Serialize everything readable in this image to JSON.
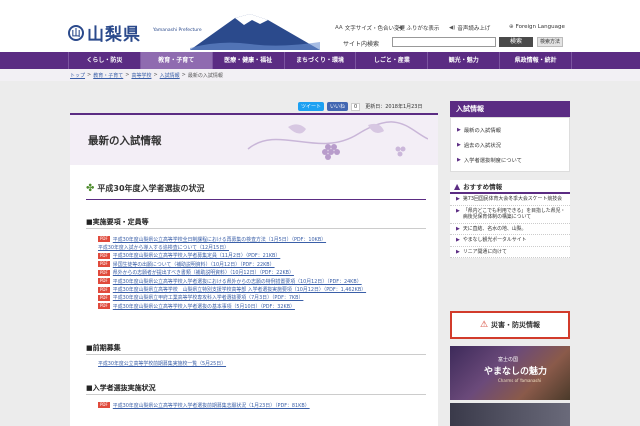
{
  "header": {
    "logo_mark": "山",
    "logo_text": "山梨県",
    "logo_sub": "Yamanashi Prefecture",
    "util_links": [
      {
        "icon": "text-size-icon",
        "glyph": "AA",
        "label": "文字サイズ・色合い変更"
      },
      {
        "icon": "speaker-icon",
        "glyph": "◀)",
        "label": "ふりがな表示"
      },
      {
        "icon": "speaker-icon",
        "glyph": "◀)",
        "label": "音声読み上げ"
      },
      {
        "icon": "globe-icon",
        "glyph": "⊕",
        "label": "Foreign Language"
      }
    ],
    "search_label": "サイト内検索",
    "search_placeholder": "",
    "search_button": "検索",
    "search_method": "検索方法"
  },
  "nav": {
    "items": [
      {
        "label": "くらし・防災"
      },
      {
        "label": "教育・子育て"
      },
      {
        "label": "医療・健康・福祉"
      },
      {
        "label": "まちづくり・環境"
      },
      {
        "label": "しごと・産業"
      },
      {
        "label": "観光・魅力"
      },
      {
        "label": "県政情報・統計"
      }
    ]
  },
  "breadcrumb": {
    "items": [
      "トップ",
      "教育・子育て",
      "高等学校",
      "入試情報",
      "最新の入試情報"
    ]
  },
  "share": {
    "tweet": "ツイート",
    "like": "いいね",
    "like_count": "0",
    "updated": "更新日：2018年1月23日"
  },
  "main": {
    "page_title": "最新の入試情報",
    "section_title": "平成30年度入学者選抜の状況",
    "sections": [
      {
        "heading": "■実施要項・定員等",
        "docs": [
          "平成30年度山梨県公立高等学校全日制課程における再募集の検査方法（1月5日）（PDF：10KB）",
          "平成30年度入試から導入する追検査について（12月15日）",
          "平成30年度山梨県公立高等学校入学者募集定員（11月2日）（PDF：21KB）",
          "帰国生徒等の出願について（補助説明資料）（10月12日）（PDF：22KB）",
          "県外からの志願者が提出すべき書類（補助説明資料）（10月12日）（PDF：22KB）",
          "平成30年度山梨県公立高等学校入学者選抜における県外からの志願の特例措置要項（10月12日）（PDF：24KB）",
          "平成30年度山梨県立高等学校　山梨県立特別支援学校高等部 入学者選抜実施要項（10月12日）（PDF：1,462KB）",
          "平成30年度山梨県立甲府工業高等学校専攻科入学者選抜要項（7月3日）（PDF：7KB）",
          "平成30年度山梨県公立高等学校入学者選抜の基本事項（5月10日）（PDF：32KB）"
        ]
      },
      {
        "heading": "■前期募集",
        "docs": [
          "平成30年度公立高等学校前期募集実施校一覧（5月25日）"
        ]
      },
      {
        "heading": "■入学者選抜実施状況",
        "docs": [
          "平成30年度山梨県公立高等学校入学者選抜前期募集志願状況（1月23日）（PDF：81KB）"
        ]
      }
    ]
  },
  "sidebar": {
    "title": "入試情報",
    "links": [
      "最新の入試情報",
      "過去の入試状況",
      "入学者選抜制度について"
    ],
    "rec_title": "おすすめ情報",
    "rec_items": [
      "第73回国民体育大会冬季大会スケート競技会",
      "「県内どこでも利用できる」を目指した県児・病後児保育体制の構築について",
      "天に直結、名水の地、山梨。",
      "やまなし観光ポータルサイト",
      "リニア開通に向けて"
    ],
    "disaster": "災害・防災情報",
    "banner_small": "富士の国",
    "banner_big": "やまなしの魅力",
    "banner_en": "Charms of Yamanashi"
  },
  "colors": {
    "brand_purple": "#5b2c83",
    "nav_active": "#8f6bb0",
    "pdf_red": "#e04a3c",
    "link_blue": "#3a5fa8"
  }
}
